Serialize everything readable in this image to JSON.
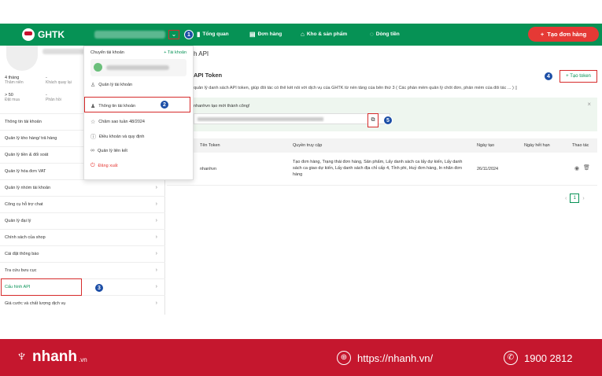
{
  "topnav": {
    "logo": "GHTK",
    "caret": "⌄",
    "badge": "1",
    "items": [
      {
        "label": "Tổng quan",
        "icon": "bar-chart-icon"
      },
      {
        "label": "Đơn hàng",
        "icon": "clipboard-icon"
      },
      {
        "label": "Kho & sản phẩm",
        "icon": "warehouse-icon"
      },
      {
        "label": "Dòng tiền",
        "icon": "money-bag-icon"
      }
    ],
    "create_label": "Tạo đơn hàng"
  },
  "sidebar": {
    "stats": [
      {
        "value": "4 tháng",
        "label": "Thâm niên"
      },
      {
        "value": "-",
        "label": "Khách quay lại"
      },
      {
        "value": "> 50",
        "label": "Đặt mua"
      },
      {
        "value": "-",
        "label": "Phân hồi"
      }
    ],
    "items": [
      {
        "label": "Thông tin tài khoản"
      },
      {
        "label": "Quản lý kho hàng/ trả hàng"
      },
      {
        "label": "Quản lý tiền & đối soát"
      },
      {
        "label": "Quản lý hóa đơn VAT"
      },
      {
        "label": "Quản lý nhóm tài khoản"
      },
      {
        "label": "Công cụ hỗ trợ chat"
      },
      {
        "label": "Quản lý đại lý"
      },
      {
        "label": "Chính sách của shop"
      },
      {
        "label": "Cài đặt thông báo"
      },
      {
        "label": "Tra cứu bưu cục"
      },
      {
        "label": "Cấu hình API"
      },
      {
        "label": "Giá cước và chất lượng dịch vụ"
      }
    ],
    "active_badge": "3"
  },
  "dropdown": {
    "header": "Chuyển tài khoản",
    "add": "+ Tài khoản",
    "items": [
      {
        "label": "Quản lý tài khoản",
        "icon": "users-icon"
      },
      {
        "label": "Thông tin tài khoản",
        "icon": "user-icon"
      },
      {
        "label": "Chăm sao tuần 48/2024",
        "icon": "star-icon"
      },
      {
        "label": "Điều khoản và quy định",
        "icon": "info-icon"
      },
      {
        "label": "Quản lý liên kết",
        "icon": "link-icon"
      },
      {
        "label": "Đăng xuất",
        "icon": "power-icon"
      }
    ],
    "selected_badge": "2"
  },
  "main": {
    "page_title": "h API",
    "section_title": "API Token",
    "description": "quản lý danh sách API token, giúp đối tác có thể kết nối với dịch vụ của GHTK từ nền tảng của bên thứ 3 ( Các phần mềm quản lý chốt đơn, phần mềm của đối tác ... )",
    "add_token": "+ Tạo token",
    "add_badge": "4",
    "notice": "nhanhvn tạo mới thành công!",
    "copy_badge": "5",
    "table": {
      "headers": [
        "Tên Token",
        "Quyền truy cập",
        "Ngày tạo",
        "Ngày hết hạn",
        "Thao tác"
      ],
      "row": {
        "name": "nhanhvn",
        "permissions": "Tạo đơn hàng, Trạng thái đơn hàng, Sản phẩm, Lấy danh sách ca lấy dự kiến, Lấy danh sách ca giao dự kiến, Lấy danh sách địa chỉ cấp 4, Tỉnh phi, Huỷ đơn hàng, In nhãn đơn hàng",
        "created": "26/11/2024",
        "expires": ""
      }
    },
    "pager": {
      "prev": "‹",
      "page": "1",
      "next": "›"
    }
  },
  "footer": {
    "brand": "nhanh",
    "brand_suffix": ".vn",
    "url": "https://nhanh.vn/",
    "phone": "1900 2812"
  }
}
